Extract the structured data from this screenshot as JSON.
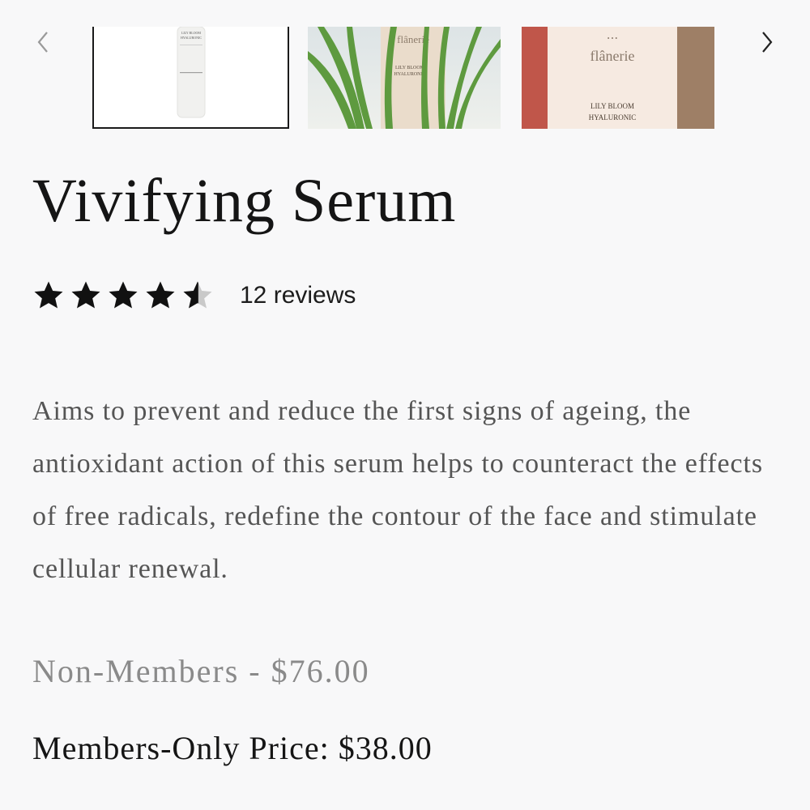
{
  "gallery": {
    "thumb1_label_lines": [
      "LILY BLOOM",
      "HYALURONIC"
    ],
    "thumb2_brand": "flânerie",
    "thumb2_label_lines": [
      "LILY BLOOM",
      "HYALURONIC"
    ],
    "thumb3_brand": "flânerie",
    "thumb3_label_lines": [
      "LILY BLOOM",
      "HYALURONIC"
    ]
  },
  "product": {
    "title": "Vivifying Serum",
    "rating_value": 4.5,
    "rating_max": 5,
    "reviews_label": "12 reviews",
    "description": "Aims to prevent and reduce the first signs of ageing, the antioxidant action of this serum helps to counteract the effects of free radicals, redefine the contour of the face and stimulate cellular renewal.",
    "price_non_members": "Non-Members - $76.00",
    "price_members": "Members-Only Price: $38.00"
  },
  "icons": {
    "prev": "chevron-left-icon",
    "next": "chevron-right-icon",
    "star": "star-icon"
  },
  "colors": {
    "background": "#f8f8f9",
    "text": "#151515",
    "muted_text": "#8a8a8a",
    "description_text": "#555555"
  }
}
